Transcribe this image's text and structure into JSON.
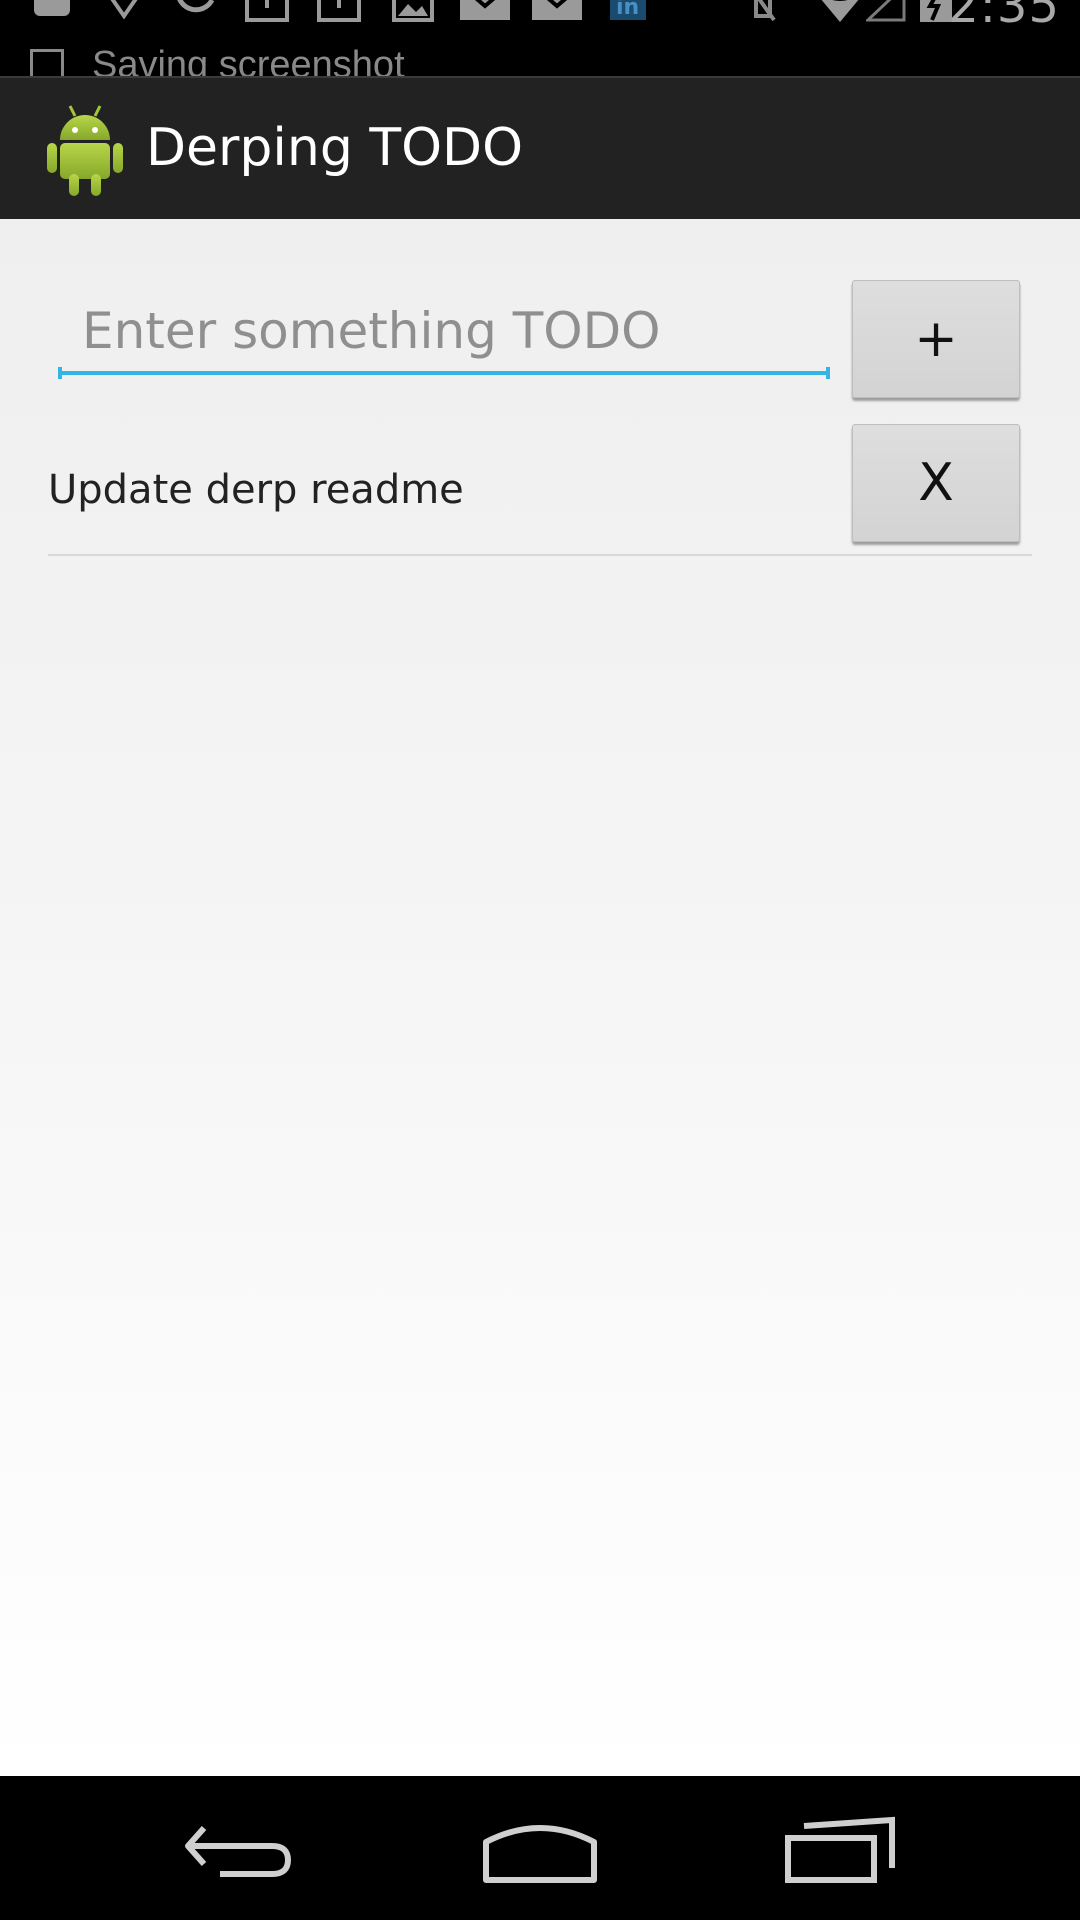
{
  "status_bar": {
    "time": "2:35",
    "toast_text": "Saving screenshot",
    "icons": [
      "notification-icon",
      "notification-icon",
      "sync-icon",
      "upload-icon",
      "upload-icon",
      "image-icon",
      "gmail-icon",
      "gmail-icon",
      "linkedin-icon",
      "vibrate-icon",
      "wifi-icon",
      "signal-icon",
      "battery-icon"
    ]
  },
  "action_bar": {
    "title": "Derping TODO",
    "icon": "android-icon"
  },
  "main": {
    "input_placeholder": "Enter something TODO",
    "add_button_label": "+",
    "items": [
      {
        "text": "Update derp readme",
        "delete_label": "X"
      }
    ]
  },
  "nav_bar": {
    "icons": [
      "back-icon",
      "home-icon",
      "recents-icon"
    ]
  },
  "colors": {
    "accent": "#33b5e5",
    "android_green": "#a4c639",
    "action_bar": "#222222"
  }
}
